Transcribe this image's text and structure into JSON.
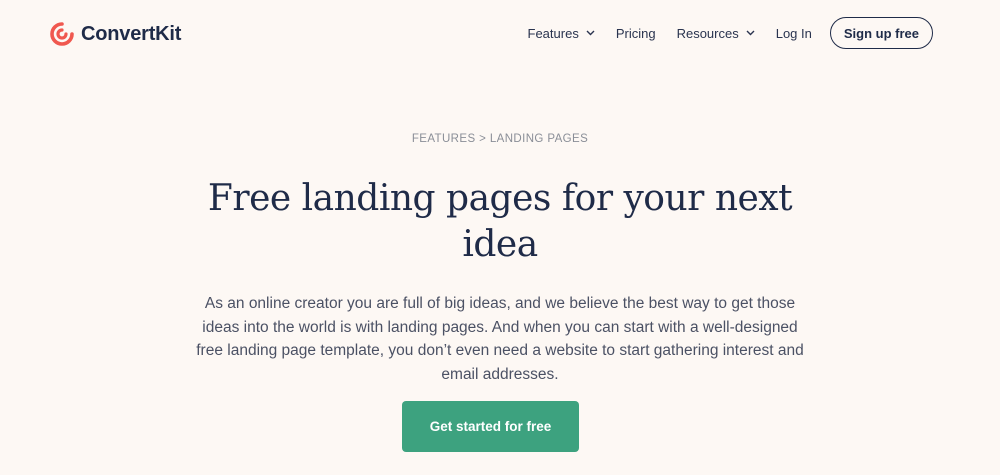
{
  "brand": {
    "name": "ConvertKit",
    "logo_icon": "convertkit-logo-icon",
    "accent_color": "#f0584f"
  },
  "nav": {
    "features_label": "Features",
    "pricing_label": "Pricing",
    "resources_label": "Resources",
    "login_label": "Log In",
    "signup_label": "Sign up free"
  },
  "breadcrumb": {
    "parent": "FEATURES",
    "separator": ">",
    "current": "LANDING PAGES"
  },
  "hero": {
    "title": "Free landing pages for your next idea",
    "lead": "As an online creator you are full of big ideas, and we believe the best way to get those ideas into the world is with landing pages. And when you can start with a well-designed free landing page template, you don’t even need a website to start gathering interest and email addresses.",
    "cta_label": "Get started for free",
    "cta_color": "#3da27f"
  },
  "colors": {
    "background": "#fdf8f4",
    "heading": "#1f2b48"
  }
}
